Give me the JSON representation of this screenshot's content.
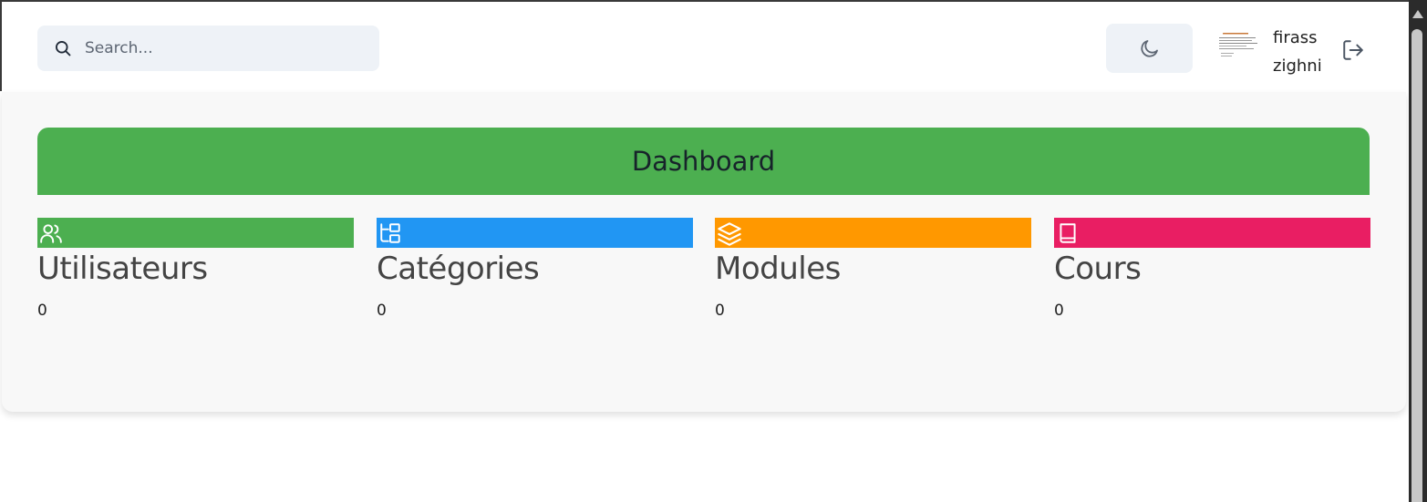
{
  "search": {
    "placeholder": "Search..."
  },
  "user": {
    "first_name": "firass",
    "last_name": "zighni"
  },
  "dashboard": {
    "title": "Dashboard"
  },
  "cards": [
    {
      "label": "Utilisateurs",
      "count": "0",
      "color": "#4caf50",
      "icon": "users-icon"
    },
    {
      "label": "Catégories",
      "count": "0",
      "color": "#2196f3",
      "icon": "folder-tree-icon"
    },
    {
      "label": "Modules",
      "count": "0",
      "color": "#ff9800",
      "icon": "layers-icon"
    },
    {
      "label": "Cours",
      "count": "0",
      "color": "#e91e63",
      "icon": "book-icon"
    }
  ]
}
